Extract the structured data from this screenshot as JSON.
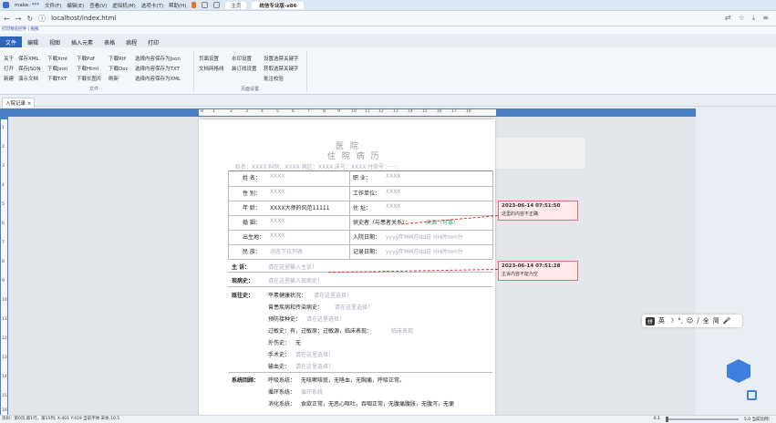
{
  "browser": {
    "tab_title": "make: ***",
    "menus": [
      "文件(F)",
      "编辑(E)",
      "查看(V)",
      "虚拟机(M)",
      "选项卡(T)",
      "帮助(H)"
    ],
    "home_tab": "主页",
    "vm_tab": "统信专业版-x86",
    "url": "localhost/index.html",
    "bookmarks": "打印预览控件 | 拖拽"
  },
  "menubar": {
    "items": [
      "文件",
      "编辑",
      "视图",
      "插入元素",
      "表格",
      "病程",
      "打印"
    ]
  },
  "ribbon": {
    "col1": [
      "关于",
      "打开",
      "新建"
    ],
    "col2": [
      "保存XML",
      "保存JSON",
      "演示文档"
    ],
    "col3": [
      "下载Xml",
      "下载Json",
      "下载TXT"
    ],
    "col4": [
      "下载Pdf",
      "下载Html",
      "下载长图片"
    ],
    "col5": [
      "下载Rtf",
      "下载Doc",
      "刷新"
    ],
    "col6": [
      "选择内容保存为Json",
      "选择内容保存为TXT",
      "选择内容保存为XML"
    ],
    "col7": [
      "页面设置",
      "文档网格线"
    ],
    "col8": [
      "水印设置",
      "装订线设置"
    ],
    "col9": [
      "设置选禁关键字",
      "获取选禁关键字",
      "批注校验"
    ],
    "group_file": "文件",
    "group_page": "页面设置"
  },
  "doc_tab": "入院记录 ×",
  "ruler": {
    "h": [
      "8",
      "1",
      "2",
      "3",
      "4",
      "5",
      "6",
      "7",
      "8",
      "9",
      "10",
      "11",
      "12",
      "13",
      "14",
      "15",
      "16",
      "17",
      "18"
    ],
    "v": [
      "1",
      "2",
      "3",
      "4",
      "5",
      "6",
      "7",
      "8",
      "9",
      "10",
      "11",
      "12",
      "13",
      "14",
      "15",
      "16"
    ]
  },
  "doc": {
    "hospital": "医 院",
    "title": "住 院 病 历",
    "header_row": "姓名：XXXX   科别：XXXX   病区：XXXX   床号：XXXX   住院号：·······",
    "rows": [
      {
        "l_label": "姓    名：",
        "l_val": "XXXX",
        "r_label": "职    业：",
        "r_val": "XXXX"
      },
      {
        "l_label": "性    别：",
        "l_val": "XXXX",
        "r_label": "工作单位：",
        "r_val": "XXXX"
      },
      {
        "l_label": "年    龄：",
        "l_val": "XXXX大师的风范11111",
        "r_label": "住    址：",
        "r_val": "XXXX"
      },
      {
        "l_label": "婚    姻：",
        "l_val": "XXXX",
        "r_label": "供史者（与患者关系）：",
        "r_val": "来源（可靠）"
      },
      {
        "l_label": "出生地：",
        "l_val": "XXXX",
        "r_label": "入院日期：",
        "r_val": "yyyy年MM月dd日 HH时mm分"
      },
      {
        "l_label": "民    族：",
        "l_val": "动态下拉列表",
        "r_label": "记录日期：",
        "r_val": "yyyy年MM月dd日 HH时mm分"
      }
    ],
    "chief_label": "主    诉：",
    "chief_ph": "请在这里输入主诉！",
    "present_label": "现病史：",
    "present_ph": "请在这里输入现病史！",
    "past_label": "既往史：",
    "past_items": [
      {
        "label": "平素健康状况：",
        "val": "请在这里选择！"
      },
      {
        "label": "曾患疾病和传染病史：",
        "val": "请在这里选择！"
      },
      {
        "label": "预防接种史：",
        "val": "请在这里选择！"
      },
      {
        "label": "过敏史：有，过敏原：过敏源，临床表现：",
        "val": "临床表现"
      },
      {
        "label": "外伤史：",
        "val": "无"
      },
      {
        "label": "手术史：",
        "val": "请在这里选择！"
      },
      {
        "label": "输血史：",
        "val": "请在这里选择！"
      }
    ],
    "review_label": "系统回顾：",
    "review_items": [
      {
        "label": "呼吸系统：",
        "val": "无咳嗽咳痰，无咯血，无胸痛，呼吸正常。"
      },
      {
        "label": "循环系统：",
        "val": "循环系统"
      },
      {
        "label": "消化系统：",
        "val": "食欲正常，无恶心呕吐，吞咽正常，无腹痛腹胀，无腹泻，无便"
      }
    ]
  },
  "comments": [
    {
      "time": "2023-06-14 07:51:50",
      "text": "这里的内容不正确"
    },
    {
      "time": "2023-06-14 07:51:28",
      "text": "主诉内容不能为空"
    }
  ],
  "ime": {
    "badge": "拼",
    "items": [
      "英",
      "☽",
      "°,",
      "☺",
      "∕",
      "全",
      "简",
      "🎤"
    ]
  },
  "status": {
    "left": "页码：第0页,第1行，第15列; X:401 Y:419 当前字体:宋体,10.5",
    "zoom_min": "0.1",
    "zoom_max": "5.0 当前比例："
  }
}
